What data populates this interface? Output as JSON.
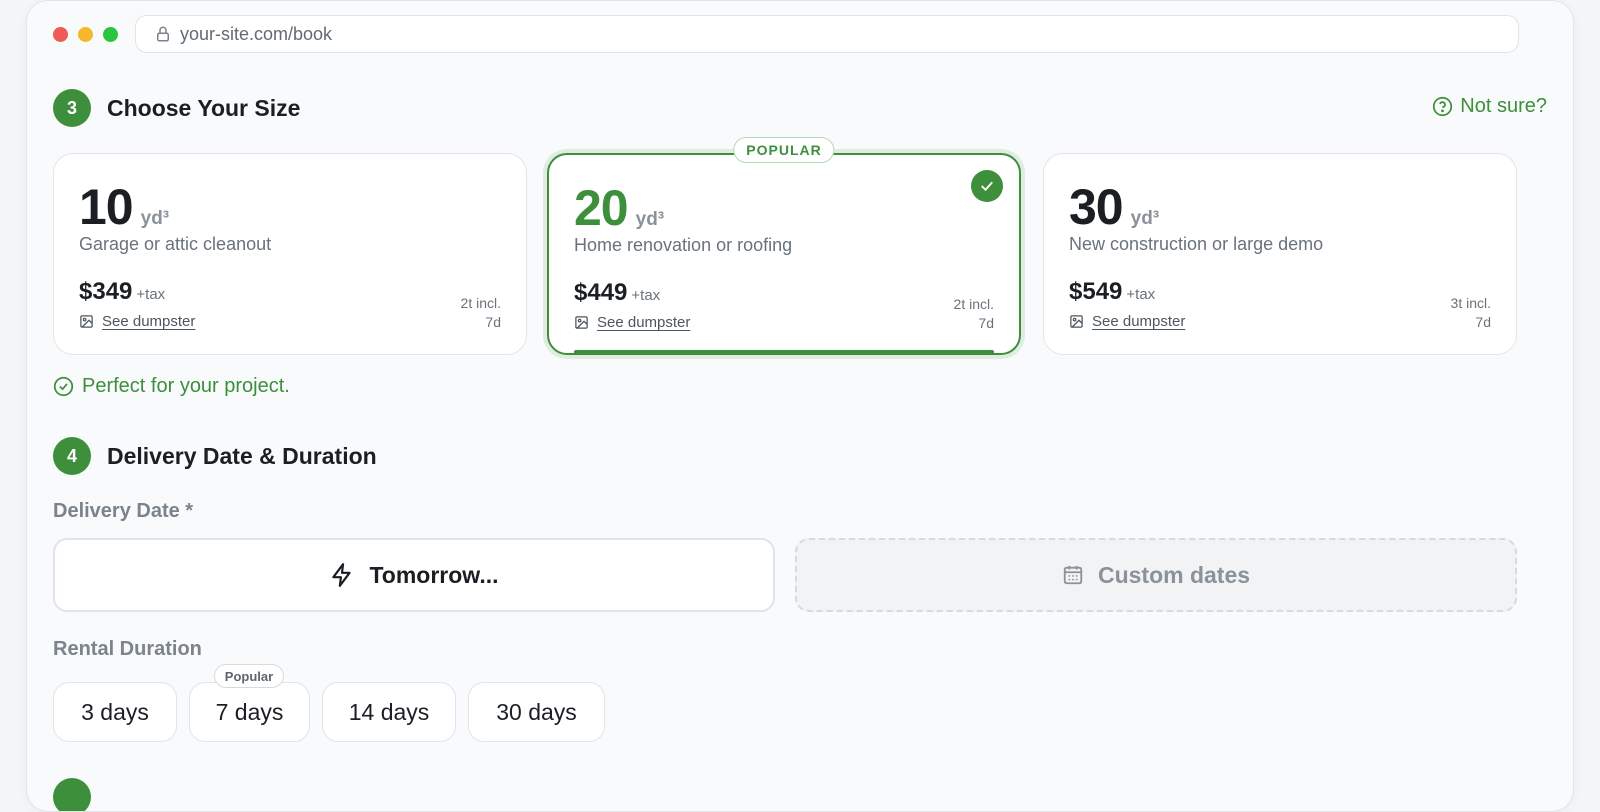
{
  "browser": {
    "url": "your-site.com/book"
  },
  "size_section": {
    "step": "3",
    "title": "Choose Your Size",
    "help_link": "Not sure?",
    "cards": [
      {
        "size": "10",
        "unit": "yd³",
        "desc": "Garage or attic cleanout",
        "price": "$349",
        "tax": "+tax",
        "see": "See dumpster",
        "incl1": "2t incl.",
        "incl2": "7d",
        "selected": false
      },
      {
        "size": "20",
        "unit": "yd³",
        "desc": "Home renovation or roofing",
        "price": "$449",
        "tax": "+tax",
        "see": "See dumpster",
        "incl1": "2t incl.",
        "incl2": "7d",
        "selected": true,
        "badge": "POPULAR"
      },
      {
        "size": "30",
        "unit": "yd³",
        "desc": "New construction or large demo",
        "price": "$549",
        "tax": "+tax",
        "see": "See dumpster",
        "incl1": "3t incl.",
        "incl2": "7d",
        "selected": false
      }
    ],
    "confirmation": "Perfect for your project."
  },
  "delivery_section": {
    "step": "4",
    "title": "Delivery Date & Duration",
    "date_label": "Delivery Date *",
    "tomorrow_button": "Tomorrow...",
    "custom_button": "Custom dates",
    "duration_label": "Rental Duration",
    "durations": [
      "3 days",
      "7 days",
      "14 days",
      "30 days"
    ],
    "duration_badge": "Popular"
  },
  "colors": {
    "accent": "#3d8f3c"
  }
}
